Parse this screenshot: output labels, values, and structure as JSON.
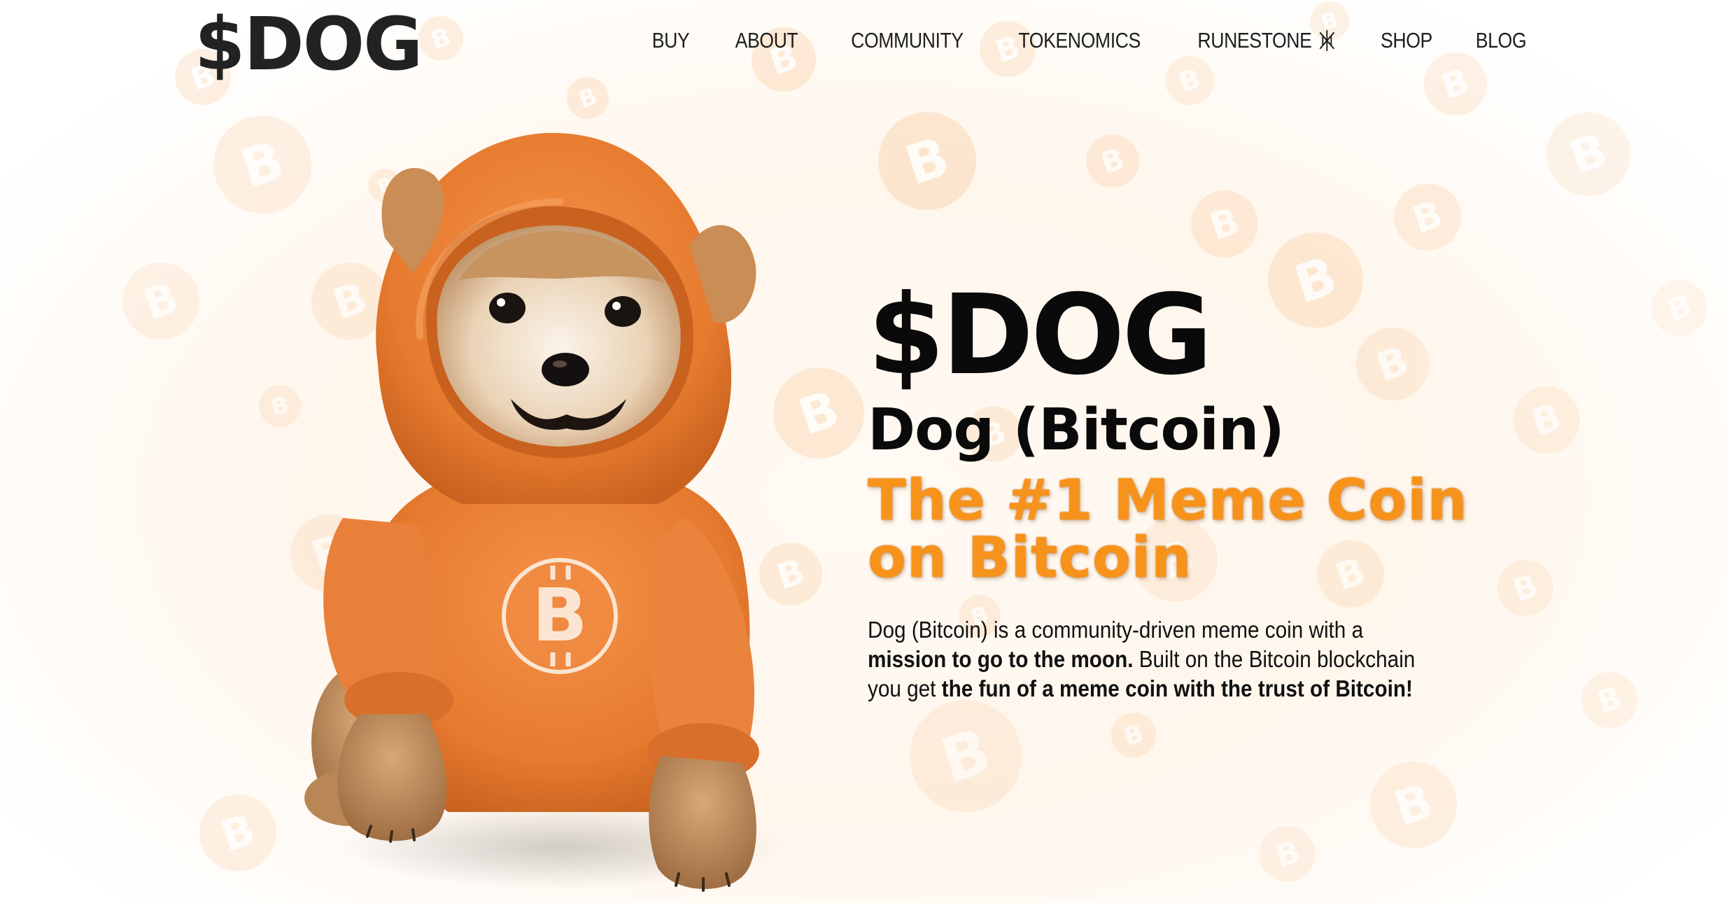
{
  "header": {
    "logo_text": "$DOG",
    "nav": [
      {
        "label": "BUY"
      },
      {
        "label": "ABOUT"
      },
      {
        "label": "COMMUNITY"
      },
      {
        "label": "TOKENOMICS"
      },
      {
        "label": "RUNESTONE",
        "icon": "rune-icon"
      },
      {
        "label": "SHOP"
      },
      {
        "label": "BLOG"
      }
    ]
  },
  "hero": {
    "title": "$DOG",
    "subtitle": "Dog (Bitcoin)",
    "tagline_line1": "The #1 Meme Coin",
    "tagline_line2": "on Bitcoin",
    "description": {
      "part1": "Dog (Bitcoin) is a community-driven meme coin with a ",
      "bold1": "mission to go to the moon.",
      "part2": " Built on the Bitcoin blockchain you get ",
      "bold2": "the fun of a meme coin with the trust of Bitcoin!"
    }
  },
  "illustration": {
    "subject": "puppy-in-orange-bitcoin-hoodie",
    "hoodie_symbol": "B"
  },
  "colors": {
    "accent": "#f7931a",
    "coin": "#fbd5b0",
    "text": "#0a0a0a"
  }
}
